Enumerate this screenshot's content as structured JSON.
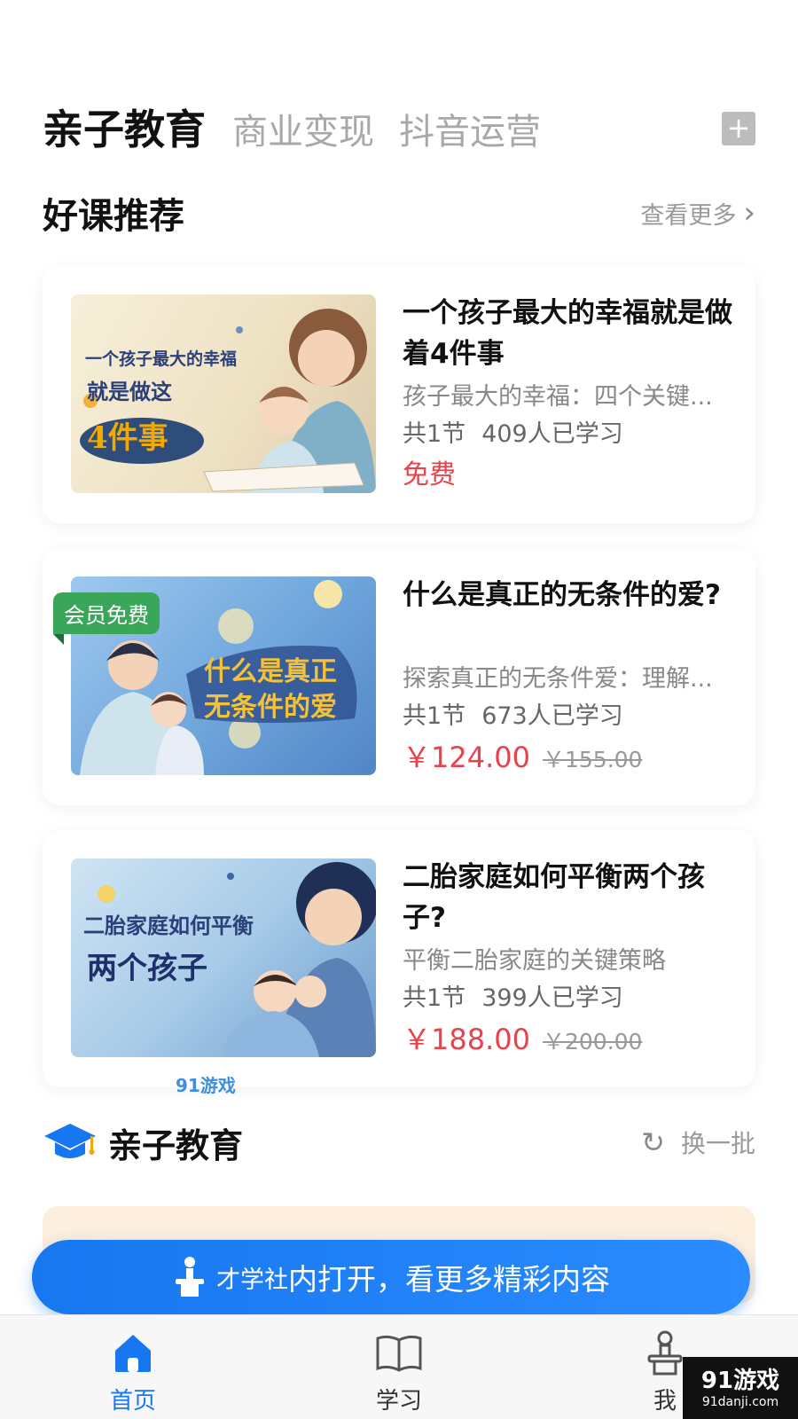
{
  "tabs": {
    "items": [
      "亲子教育",
      "商业变现",
      "抖音运营"
    ],
    "add_label": "+"
  },
  "recommend": {
    "title": "好课推荐",
    "more_label": "查看更多",
    "chev": "›"
  },
  "courses": [
    {
      "title": "一个孩子最大的幸福就是做着4件事",
      "desc": "孩子最大的幸福：四个关键...",
      "sections": "共1节",
      "learners": "409人已学习",
      "price": "免费",
      "orig_price": "",
      "thumb_line1": "一个孩子最大的幸福",
      "thumb_line2": "就是做这",
      "thumb_line3": "4件事",
      "thumb_color": "#f3ead3"
    },
    {
      "title": "什么是真正的无条件的爱?",
      "desc": "探索真正的无条件爱：理解...",
      "sections": "共1节",
      "learners": "673人已学习",
      "price": "￥124.00",
      "orig_price": "￥155.00",
      "badge": "会员免费",
      "thumb_line1": "什么是真正",
      "thumb_line2": "无条件的爱",
      "thumb_color": "#8dbde8"
    },
    {
      "title": "二胎家庭如何平衡两个孩子?",
      "desc": "平衡二胎家庭的关键策略",
      "sections": "共1节",
      "learners": "399人已学习",
      "price": "￥188.00",
      "orig_price": "￥200.00",
      "thumb_line1": "二胎家庭如何平衡",
      "thumb_line2": "两个孩子",
      "thumb_color": "#a9cdea"
    }
  ],
  "section2": {
    "title": "亲子教育",
    "refresh_label": "换一批",
    "refresh_icon": "↻"
  },
  "open_button": {
    "brand": "才学社",
    "label": "内打开，看更多精彩内容"
  },
  "tabbar": {
    "items": [
      {
        "label": "首页",
        "icon": "home-icon",
        "active": true
      },
      {
        "label": "学习",
        "icon": "book-icon",
        "active": false
      },
      {
        "label": "我",
        "icon": "person-icon",
        "active": false
      }
    ]
  },
  "watermark": {
    "logo": "91游戏",
    "sub": "91danji.com"
  },
  "colors": {
    "accent": "#1777f0",
    "price": "#e8424b",
    "badge": "#3aa65a"
  }
}
